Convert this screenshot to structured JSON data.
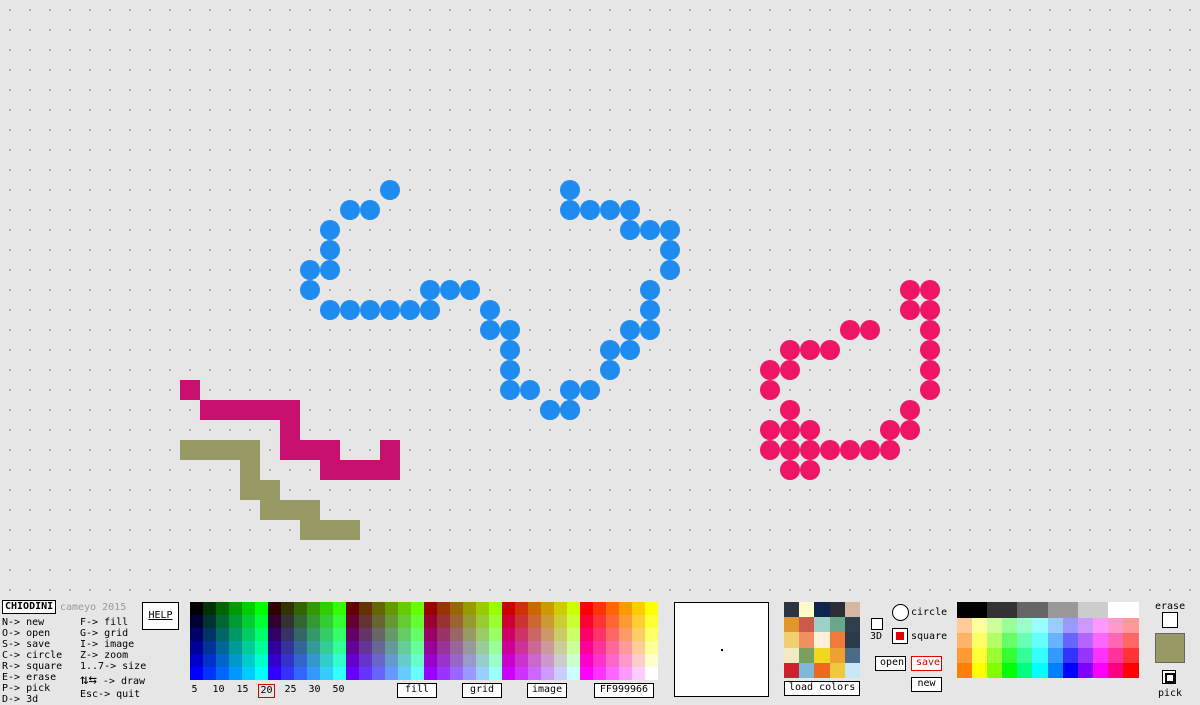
{
  "app": {
    "title": "CHIODINI",
    "subtitle": "cameyo 2015",
    "help_button": "HELP"
  },
  "shortcuts_left": [
    "N-> new",
    "O-> open",
    "S-> save",
    "C-> circle",
    "R-> square",
    "E-> erase",
    "P-> pick",
    "D-> 3d"
  ],
  "shortcuts_right": [
    "F-> fill",
    "G-> grid",
    "I-> image",
    "Z-> zoom",
    "1..7-> size",
    "-> draw",
    "Esc-> quit"
  ],
  "sizes": [
    "5",
    "10",
    "15",
    "20",
    "25",
    "30",
    "50"
  ],
  "selected_size": "20",
  "buttons": {
    "fill": "fill",
    "grid": "grid",
    "image": "image",
    "color_code": "FF999966",
    "load_colors": "load colors",
    "open": "open",
    "save": "save",
    "new": "new",
    "erase": "erase",
    "pick": "pick"
  },
  "shape": {
    "label_3d": "3D",
    "circle": "circle",
    "square": "square",
    "selected": "square"
  },
  "current_color": "#999966",
  "icons": [
    "updown-arrow-icon",
    "leftright-arrow-icon",
    "circle-shape-icon",
    "square-shape-icon",
    "erase-box-icon",
    "pick-target-icon"
  ],
  "drawing": {
    "blue": "#1e8bf0",
    "pink": "#f01466",
    "magenta": "#c8106e",
    "olive": "#999966",
    "blue_circles": [
      [
        19,
        9
      ],
      [
        17,
        10
      ],
      [
        18,
        10
      ],
      [
        16,
        11
      ],
      [
        16,
        12
      ],
      [
        15,
        13
      ],
      [
        16,
        13
      ],
      [
        15,
        14
      ],
      [
        21,
        14
      ],
      [
        22,
        14
      ],
      [
        23,
        14
      ],
      [
        16,
        15
      ],
      [
        17,
        15
      ],
      [
        18,
        15
      ],
      [
        19,
        15
      ],
      [
        20,
        15
      ],
      [
        21,
        15
      ],
      [
        24,
        15
      ],
      [
        24,
        16
      ],
      [
        25,
        16
      ],
      [
        25,
        17
      ],
      [
        25,
        18
      ],
      [
        25,
        19
      ],
      [
        26,
        19
      ],
      [
        27,
        20
      ],
      [
        28,
        20
      ],
      [
        28,
        9
      ],
      [
        28,
        10
      ],
      [
        29,
        10
      ],
      [
        30,
        10
      ],
      [
        31,
        10
      ],
      [
        31,
        11
      ],
      [
        32,
        11
      ],
      [
        33,
        11
      ],
      [
        33,
        12
      ],
      [
        33,
        13
      ],
      [
        32,
        14
      ],
      [
        32,
        15
      ],
      [
        31,
        16
      ],
      [
        32,
        16
      ],
      [
        30,
        17
      ],
      [
        31,
        17
      ],
      [
        30,
        18
      ],
      [
        28,
        19
      ],
      [
        29,
        19
      ],
      [
        27,
        20
      ],
      [
        28,
        20
      ]
    ],
    "pink_circles": [
      [
        45,
        14
      ],
      [
        46,
        14
      ],
      [
        45,
        15
      ],
      [
        46,
        15
      ],
      [
        42,
        16
      ],
      [
        43,
        16
      ],
      [
        46,
        16
      ],
      [
        39,
        17
      ],
      [
        40,
        17
      ],
      [
        41,
        17
      ],
      [
        46,
        17
      ],
      [
        38,
        18
      ],
      [
        39,
        18
      ],
      [
        46,
        18
      ],
      [
        38,
        19
      ],
      [
        46,
        19
      ],
      [
        39,
        20
      ],
      [
        45,
        20
      ],
      [
        38,
        21
      ],
      [
        39,
        21
      ],
      [
        40,
        21
      ],
      [
        44,
        21
      ],
      [
        45,
        21
      ],
      [
        38,
        22
      ],
      [
        39,
        22
      ],
      [
        40,
        22
      ],
      [
        41,
        22
      ],
      [
        42,
        22
      ],
      [
        43,
        22
      ],
      [
        44,
        22
      ],
      [
        39,
        23
      ],
      [
        40,
        23
      ]
    ],
    "magenta_squares": [
      [
        9,
        19
      ],
      [
        10,
        20
      ],
      [
        11,
        20
      ],
      [
        12,
        20
      ],
      [
        13,
        20
      ],
      [
        14,
        20
      ],
      [
        14,
        21
      ],
      [
        14,
        22
      ],
      [
        15,
        22
      ],
      [
        16,
        22
      ],
      [
        19,
        22
      ],
      [
        16,
        23
      ],
      [
        17,
        23
      ],
      [
        18,
        23
      ],
      [
        19,
        23
      ]
    ],
    "olive_squares": [
      [
        9,
        22
      ],
      [
        10,
        22
      ],
      [
        11,
        22
      ],
      [
        12,
        22
      ],
      [
        12,
        23
      ],
      [
        12,
        24
      ],
      [
        13,
        24
      ],
      [
        13,
        25
      ],
      [
        14,
        25
      ],
      [
        15,
        25
      ],
      [
        15,
        26
      ],
      [
        16,
        26
      ],
      [
        17,
        26
      ]
    ]
  },
  "palette_main": [
    [
      "#000000",
      "#003300",
      "#006600",
      "#009900",
      "#00cc00",
      "#00ff00",
      "#330000",
      "#333300",
      "#336600",
      "#339900",
      "#33cc00",
      "#33ff00",
      "#660000",
      "#663300",
      "#666600",
      "#669900",
      "#66cc00",
      "#66ff00",
      "#990000",
      "#993300",
      "#996600",
      "#999900",
      "#99cc00",
      "#99ff00",
      "#cc0000",
      "#cc3300",
      "#cc6600",
      "#cc9900",
      "#cccc00",
      "#ccff00",
      "#ff0000",
      "#ff3300",
      "#ff6600",
      "#ff9900",
      "#ffcc00",
      "#ffff00"
    ],
    [
      "#000033",
      "#003333",
      "#006633",
      "#009933",
      "#00cc33",
      "#00ff33",
      "#330033",
      "#333333",
      "#336633",
      "#339933",
      "#33cc33",
      "#33ff33",
      "#660033",
      "#663333",
      "#666633",
      "#669933",
      "#66cc33",
      "#66ff33",
      "#990033",
      "#993333",
      "#996633",
      "#999933",
      "#99cc33",
      "#99ff33",
      "#cc0033",
      "#cc3333",
      "#cc6633",
      "#cc9933",
      "#cccc33",
      "#ccff33",
      "#ff0033",
      "#ff3333",
      "#ff6633",
      "#ff9933",
      "#ffcc33",
      "#ffff33"
    ],
    [
      "#000066",
      "#003366",
      "#006666",
      "#009966",
      "#00cc66",
      "#00ff66",
      "#330066",
      "#333366",
      "#336666",
      "#339966",
      "#33cc66",
      "#33ff66",
      "#660066",
      "#663366",
      "#666666",
      "#669966",
      "#66cc66",
      "#66ff66",
      "#990066",
      "#993366",
      "#996666",
      "#999966",
      "#99cc66",
      "#99ff66",
      "#cc0066",
      "#cc3366",
      "#cc6666",
      "#cc9966",
      "#cccc66",
      "#ccff66",
      "#ff0066",
      "#ff3366",
      "#ff6666",
      "#ff9966",
      "#ffcc66",
      "#ffff66"
    ],
    [
      "#000099",
      "#003399",
      "#006699",
      "#009999",
      "#00cc99",
      "#00ff99",
      "#330099",
      "#333399",
      "#336699",
      "#339999",
      "#33cc99",
      "#33ff99",
      "#660099",
      "#663399",
      "#666699",
      "#669999",
      "#66cc99",
      "#66ff99",
      "#990099",
      "#993399",
      "#996699",
      "#999999",
      "#99cc99",
      "#99ff99",
      "#cc0099",
      "#cc3399",
      "#cc6699",
      "#cc9999",
      "#cccc99",
      "#ccff99",
      "#ff0099",
      "#ff3399",
      "#ff6699",
      "#ff9999",
      "#ffcc99",
      "#ffff99"
    ],
    [
      "#0000cc",
      "#0033cc",
      "#0066cc",
      "#0099cc",
      "#00cccc",
      "#00ffcc",
      "#3300cc",
      "#3333cc",
      "#3366cc",
      "#3399cc",
      "#33cccc",
      "#33ffcc",
      "#6600cc",
      "#6633cc",
      "#6666cc",
      "#6699cc",
      "#66cccc",
      "#66ffcc",
      "#9900cc",
      "#9933cc",
      "#9966cc",
      "#9999cc",
      "#99cccc",
      "#99ffcc",
      "#cc00cc",
      "#cc33cc",
      "#cc66cc",
      "#cc99cc",
      "#cccccc",
      "#ccffcc",
      "#ff00cc",
      "#ff33cc",
      "#ff66cc",
      "#ff99cc",
      "#ffcccc",
      "#ffffcc"
    ],
    [
      "#0000ff",
      "#0033ff",
      "#0066ff",
      "#0099ff",
      "#00ccff",
      "#00ffff",
      "#3300ff",
      "#3333ff",
      "#3366ff",
      "#3399ff",
      "#33ccff",
      "#33ffff",
      "#6600ff",
      "#6633ff",
      "#6666ff",
      "#6699ff",
      "#66ccff",
      "#66ffff",
      "#9900ff",
      "#9933ff",
      "#9966ff",
      "#9999ff",
      "#99ccff",
      "#99ffff",
      "#cc00ff",
      "#cc33ff",
      "#cc66ff",
      "#cc99ff",
      "#ccccff",
      "#ccffff",
      "#ff00ff",
      "#ff33ff",
      "#ff66ff",
      "#ff99ff",
      "#ffccff",
      "#ffffff"
    ]
  ],
  "palette_custom": [
    [
      "#2b3440",
      "#fffccc",
      "#0f2550",
      "#2d2d3a",
      "#d4b8a0"
    ],
    [
      "#e0962a",
      "#cc5a4a",
      "#9fd0c8",
      "#6aa68a",
      "#2f3f4c"
    ],
    [
      "#f0d070",
      "#f09060",
      "#fff0d8",
      "#f07a3a",
      "#2a3a4a"
    ],
    [
      "#f2eac0",
      "#7aa060",
      "#f0d820",
      "#f0a030",
      "#4a6a8a"
    ],
    [
      "#d02030",
      "#80b8d8",
      "#f06820",
      "#f0c840",
      "#c8e8f8"
    ]
  ],
  "palette_right": [
    [
      "#000000",
      "#333333",
      "#666666",
      "#999999",
      "#cccccc",
      "#ffffff"
    ],
    [
      "#ffcc99",
      "#ffff99",
      "#ccff99",
      "#99ff99",
      "#99ffcc",
      "#99ffff",
      "#99ccff",
      "#9999ff",
      "#cc99ff",
      "#ff99ff",
      "#ff99cc",
      "#ff9999"
    ],
    [
      "#ffb366",
      "#ffff66",
      "#b3ff66",
      "#66ff66",
      "#66ffb3",
      "#66ffff",
      "#66b3ff",
      "#6666ff",
      "#b366ff",
      "#ff66ff",
      "#ff66b3",
      "#ff6666"
    ],
    [
      "#ff9933",
      "#ffff33",
      "#99ff33",
      "#33ff33",
      "#33ff99",
      "#33ffff",
      "#3399ff",
      "#3333ff",
      "#9933ff",
      "#ff33ff",
      "#ff3399",
      "#ff3333"
    ],
    [
      "#ff8000",
      "#ffff00",
      "#80ff00",
      "#00ff00",
      "#00ff80",
      "#00ffff",
      "#0080ff",
      "#0000ff",
      "#8000ff",
      "#ff00ff",
      "#ff0080",
      "#ff0000"
    ]
  ]
}
